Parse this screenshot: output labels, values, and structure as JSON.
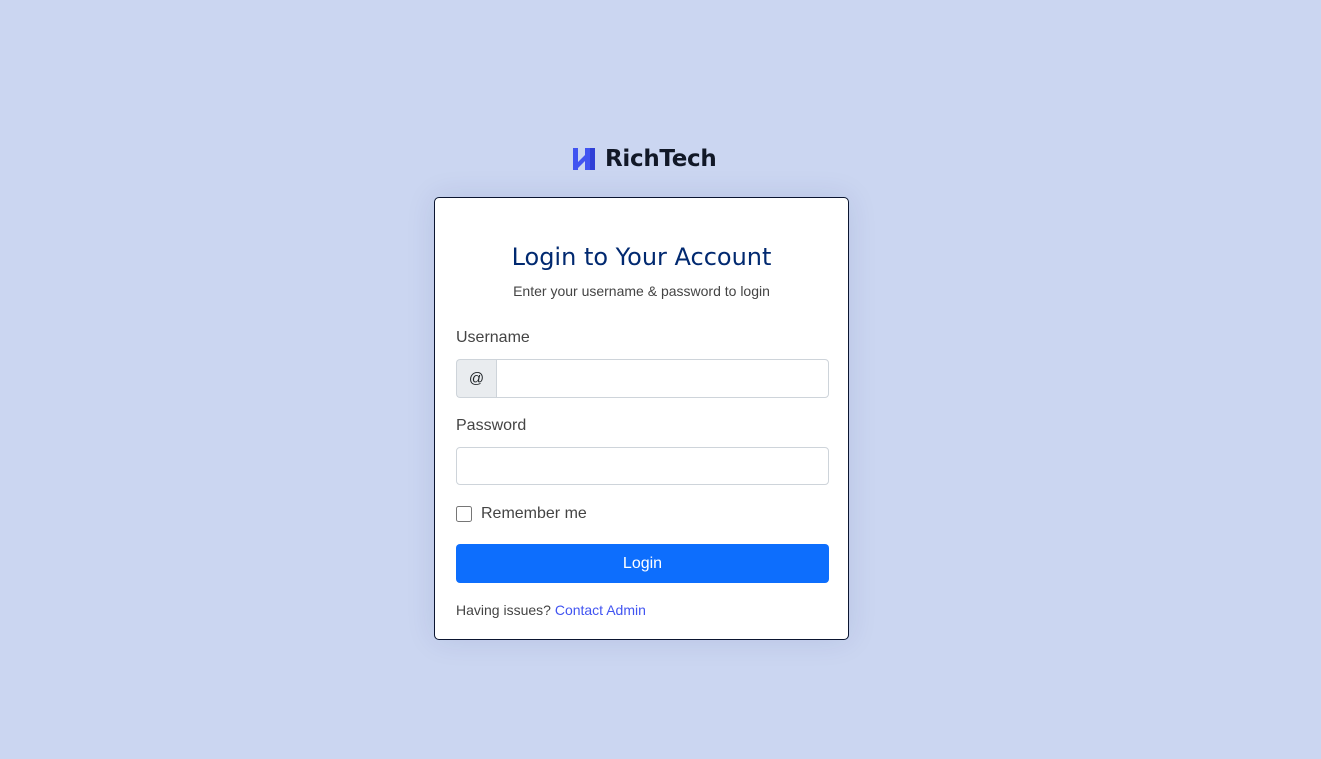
{
  "brand": {
    "name": "RichTech",
    "logo_icon": "richtech-logo-icon",
    "logo_color": "#4154f1"
  },
  "card": {
    "title": "Login to Your Account",
    "subtitle": "Enter your username & password to login"
  },
  "form": {
    "username_label": "Username",
    "username_prefix": "@",
    "username_value": "",
    "password_label": "Password",
    "password_value": "",
    "remember_label": "Remember me",
    "remember_checked": false,
    "login_button": "Login"
  },
  "footer": {
    "issues_text": "Having issues?",
    "contact_link": "Contact Admin"
  },
  "colors": {
    "background": "#cbd6f1",
    "title": "#012970",
    "primary_button": "#0d6efd",
    "link": "#4154f1"
  }
}
